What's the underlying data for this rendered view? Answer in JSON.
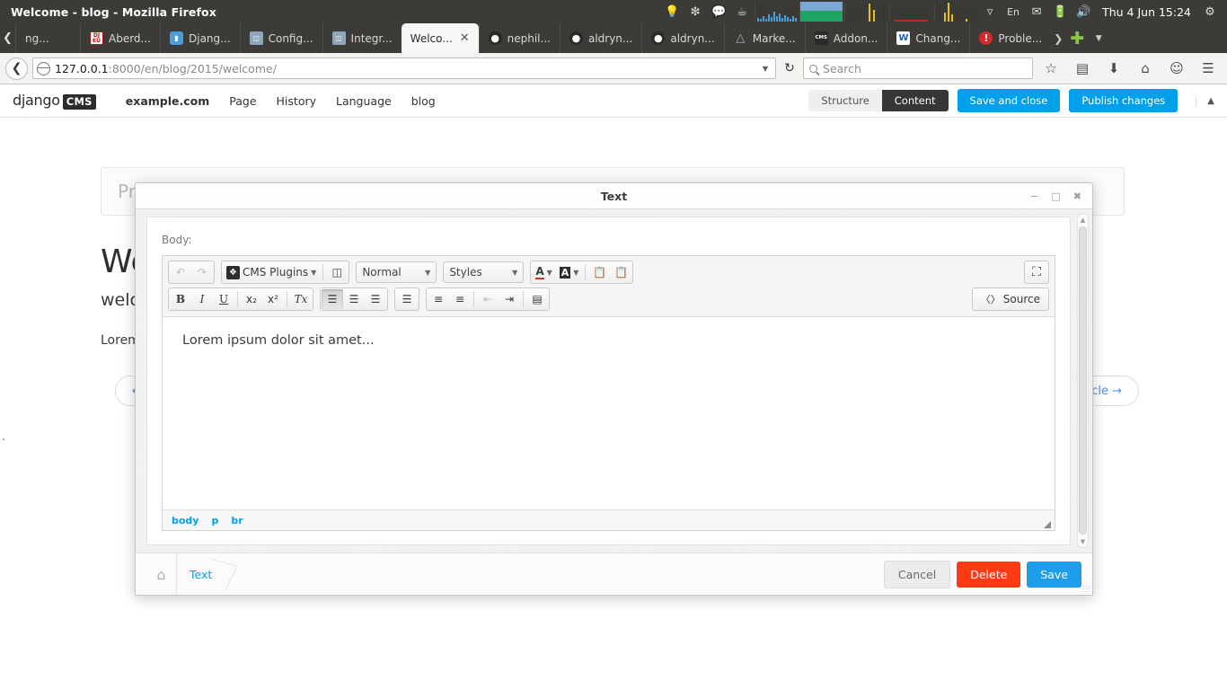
{
  "os": {
    "window_title": "Welcome - blog - Mozilla Firefox",
    "clock": "Thu  4 Jun 15:24",
    "tray": [
      {
        "name": "lightbulb-icon",
        "glyph": "Ὂ1"
      },
      {
        "name": "dropbox-icon",
        "glyph": "❇"
      },
      {
        "name": "speech-bubble-icon",
        "glyph": "”"
      },
      {
        "name": "coffee-cup-icon",
        "glyph": "☕"
      },
      {
        "name": "network-graph-widget",
        "glyph": ""
      },
      {
        "name": "cpu-graph-widget",
        "glyph": ""
      },
      {
        "name": "disk-graph-widget",
        "glyph": ""
      },
      {
        "name": "memory-graph-widget",
        "glyph": ""
      },
      {
        "name": "load-graph-widget",
        "glyph": ""
      },
      {
        "name": "shield-icon",
        "glyph": "▽"
      },
      {
        "name": "keyboard-layout-icon",
        "glyph": "En"
      },
      {
        "name": "mail-icon",
        "glyph": "✉"
      },
      {
        "name": "battery-icon",
        "glyph": "▮"
      },
      {
        "name": "volume-icon",
        "glyph": "🔊"
      },
      {
        "name": "power-gear-icon",
        "glyph": "⚙"
      }
    ]
  },
  "browser": {
    "tabs": [
      {
        "label": "ng...",
        "favicon": "none",
        "active": false
      },
      {
        "label": "Aberd...",
        "favicon": "dju",
        "active": false
      },
      {
        "label": "Djang...",
        "favicon": "django",
        "active": false
      },
      {
        "label": "Config...",
        "favicon": "doc",
        "active": false
      },
      {
        "label": "Integr...",
        "favicon": "doc",
        "active": false
      },
      {
        "label": "Welco...",
        "favicon": "none",
        "active": true
      },
      {
        "label": "nephil...",
        "favicon": "gh",
        "active": false
      },
      {
        "label": "aldryn...",
        "favicon": "gh",
        "active": false
      },
      {
        "label": "aldryn...",
        "favicon": "gh",
        "active": false
      },
      {
        "label": "Marke...",
        "favicon": "mk",
        "active": false
      },
      {
        "label": "Addon...",
        "favicon": "cms",
        "active": false
      },
      {
        "label": "Chang...",
        "favicon": "va",
        "active": false
      },
      {
        "label": "Proble...",
        "favicon": "err",
        "active": false
      }
    ],
    "url_host": "127.0.0.1",
    "url_rest": ":8000/en/blog/2015/welcome/",
    "search_placeholder": "Search",
    "nav_icons": [
      {
        "name": "bookmark-star-icon",
        "glyph": "☆"
      },
      {
        "name": "reader-view-icon",
        "glyph": "▤"
      },
      {
        "name": "downloads-icon",
        "glyph": "↓"
      },
      {
        "name": "home-icon",
        "glyph": "⌂"
      },
      {
        "name": "hello-smiley-icon",
        "glyph": "☺"
      },
      {
        "name": "hamburger-menu-icon",
        "glyph": "☰"
      }
    ]
  },
  "cms_toolbar": {
    "logo_django": "django",
    "logo_cms": "CMS",
    "site": "example.com",
    "menus": [
      "Page",
      "History",
      "Language",
      "blog"
    ],
    "mode_structure": "Structure",
    "mode_content": "Content",
    "save_and_close": "Save and close",
    "publish_changes": "Publish changes"
  },
  "page": {
    "placeholder_text": "Pre",
    "title": "We",
    "lead": "welc",
    "body": "Lorem",
    "pager_prev": "←",
    "pager_next": "icle →",
    "stray_dot": "."
  },
  "modal": {
    "title": "Text",
    "win_minimize": "−",
    "win_maximize": "□",
    "win_close": "✖",
    "body_label": "Body:",
    "editor": {
      "undo": "↶",
      "redo": "↷",
      "cms_plugins": "CMS Plugins",
      "image_button": "image-placeholder",
      "format": "Normal",
      "styles": "Styles",
      "text_color": "A",
      "bg_color": "A",
      "paste_text": "paste-as-plain-text",
      "paste_word": "paste-from-word",
      "maximize": "maximize",
      "bold": "B",
      "italic": "I",
      "underline": "U",
      "subscript": "x₂",
      "superscript": "x²",
      "remove_format": "Tx",
      "align_left": "align-left",
      "align_center": "align-center",
      "align_right": "align-right",
      "justify": "justify",
      "numbered_list": "numbered-list",
      "bulleted_list": "bulleted-list",
      "outdent": "outdent",
      "indent": "indent",
      "table": "table",
      "source": "Source",
      "content": "Lorem ipsum dolor sit amet...",
      "path": [
        "body",
        "p",
        "br"
      ]
    },
    "breadcrumb": "Text",
    "cancel": "Cancel",
    "delete": "Delete",
    "save": "Save"
  },
  "colors": {
    "accent_blue": "#00a0ea",
    "danger_red": "#ff3b14",
    "toolbar_dark": "#3c3b37"
  }
}
